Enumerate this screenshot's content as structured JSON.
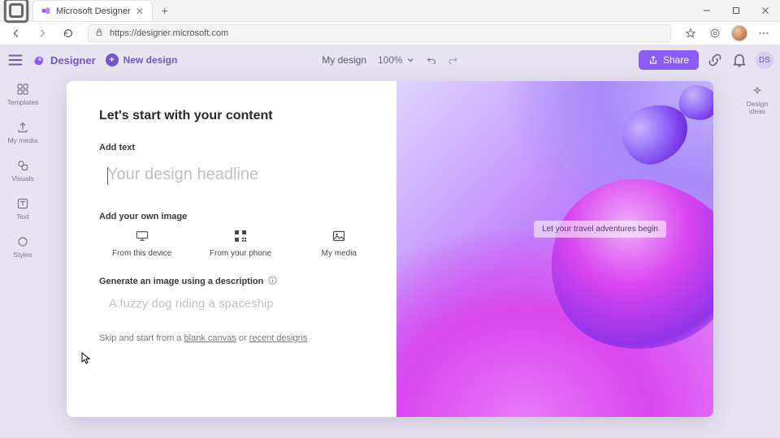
{
  "browser": {
    "tab_title": "Microsoft Designer",
    "url": "https://designer.microsoft.com"
  },
  "app_bar": {
    "brand": "Designer",
    "new_design": "New design",
    "doc_name": "My design",
    "zoom": "100%",
    "share": "Share",
    "user_initials": "DS"
  },
  "rail": {
    "templates": "Templates",
    "my_media": "My media",
    "visuals": "Visuals",
    "text": "Text",
    "styles": "Styles"
  },
  "right_rail": {
    "design_ideas": "Design ideas"
  },
  "modal": {
    "title": "Let's start with your content",
    "add_text_label": "Add text",
    "headline_placeholder": "Your design headline",
    "add_image_label": "Add your own image",
    "sources": {
      "device": "From this device",
      "phone": "From your phone",
      "media": "My media"
    },
    "generate_label": "Generate an image using a description",
    "generate_placeholder": "A fuzzy dog riding a spaceship",
    "skip_prefix": "Skip and start from a ",
    "blank_canvas": "blank canvas",
    "skip_mid": " or ",
    "recent_designs": "recent designs"
  },
  "preview_overlay": "Let your travel adventures begin"
}
